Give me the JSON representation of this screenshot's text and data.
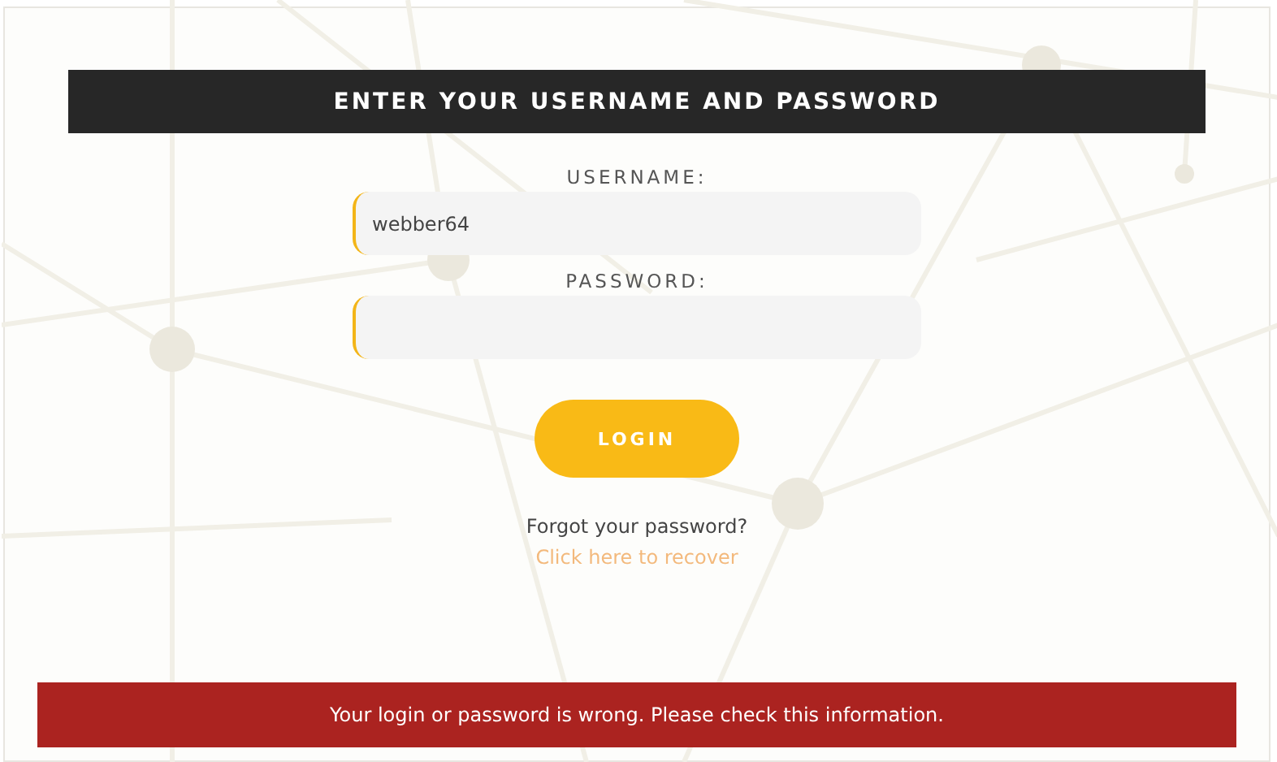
{
  "heading": "ENTER YOUR USERNAME AND PASSWORD",
  "fields": [
    {
      "label": "USERNAME:",
      "value": "webber64"
    },
    {
      "label": "PASSWORD:"
    }
  ],
  "login_button": "LOGIN",
  "forgot_text": "Forgot your password?",
  "recover_link": "Click here to recover",
  "error_message": "Your login or password is wrong. Please check this information."
}
